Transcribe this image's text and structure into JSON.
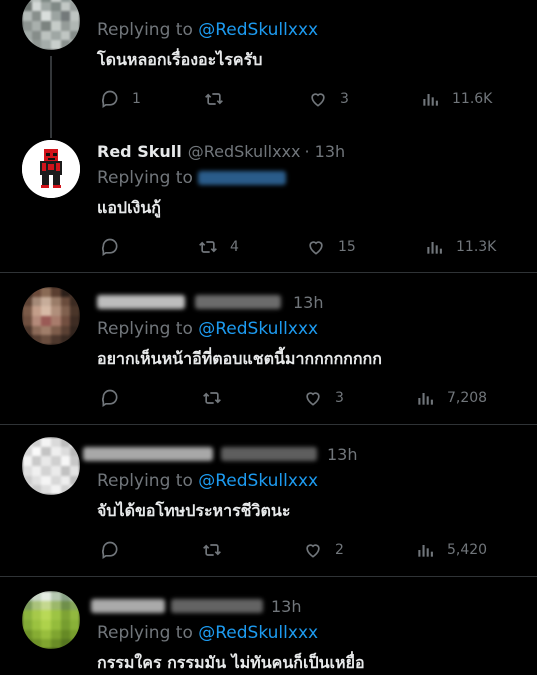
{
  "tweets": [
    {
      "name": "",
      "handle": "",
      "time": "",
      "replying_label": "Replying to",
      "replying_to": "@RedSkullxxx",
      "text": "โดนหลอกเรื่องอะไรครับ",
      "replies": "1",
      "retweets": "",
      "likes": "3",
      "views": "11.6K"
    },
    {
      "name": "Red Skull",
      "handle": "@RedSkullxxx",
      "time": "· 13h",
      "replying_label": "Replying to",
      "replying_to": "",
      "text": "แอปเงินกู้",
      "replies": "",
      "retweets": "4",
      "likes": "15",
      "views": "11.3K"
    },
    {
      "name": "",
      "handle": "",
      "time": "13h",
      "replying_label": "Replying to",
      "replying_to": "@RedSkullxxx",
      "text": "อยากเห็นหน้าอีที่ตอบแชตนี้มากกกกกกกก",
      "replies": "",
      "retweets": "",
      "likes": "3",
      "views": "7,208"
    },
    {
      "name": "",
      "handle": "",
      "time": "13h",
      "replying_label": "Replying to",
      "replying_to": "@RedSkullxxx",
      "text": "จับได้ขอโทษประหารชีวิตนะ",
      "replies": "",
      "retweets": "",
      "likes": "2",
      "views": "5,420"
    },
    {
      "name": "",
      "handle": "",
      "time": "13h",
      "replying_label": "Replying to",
      "replying_to": "@RedSkullxxx",
      "text": "กรรมใคร กรรมมัน ไม่ทันคนก็เป็นเหยื่อ",
      "replies": "",
      "retweets": "",
      "likes": "",
      "views": ""
    }
  ],
  "colors": {
    "background": "#000000",
    "text": "#e7e9ea",
    "muted": "#71767b",
    "link": "#1d9bf0",
    "divider": "#2f3336"
  }
}
